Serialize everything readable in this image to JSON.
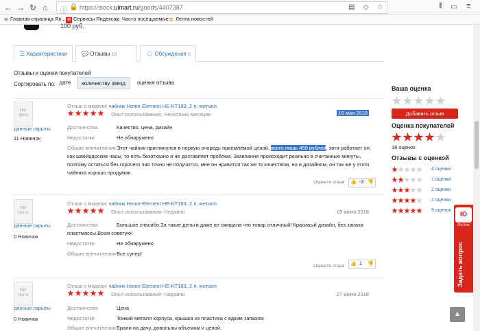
{
  "browser": {
    "url_prefix": "https://stock.",
    "url_host": "ulmart.ru",
    "url_path": "/goods/4407387",
    "bookmarks": [
      {
        "icon": "yandex-icon",
        "label": "Главная страница Ян..."
      },
      {
        "icon": "yandex-services-icon",
        "label": "Сервисы Яндекса"
      },
      {
        "icon": "gear-icon",
        "label": "Часто посещаемые"
      },
      {
        "icon": "news-icon",
        "label": "Лента новостей"
      }
    ]
  },
  "product": {
    "price_fragment": "100 руб."
  },
  "tabs": [
    {
      "label": "Характеристики",
      "count": ""
    },
    {
      "label": "Отзывы",
      "count": "18"
    },
    {
      "label": "Обсуждения",
      "count": "0"
    }
  ],
  "reviews_section": {
    "title": "Отзывы и оценки покупателей",
    "sort_label": "Сортировать по:",
    "sort_options": [
      "дате",
      "количеству звезд",
      "оценке отзыва"
    ]
  },
  "reviews": [
    {
      "avatar": "Нет фото",
      "hidden": "данные скрыты",
      "rank": "11 Новичок",
      "model_prefix": "Отзыв о модели:",
      "model": "чайник Home-Element HE-KT183, 2 л, металл",
      "stars": 5,
      "experience": "Опыт использования: Несколько месяцев",
      "date": "16 мая 2018",
      "pros_label": "Достоинства",
      "pros": "Качество, цена, дизайн",
      "cons_label": "Недостатки",
      "cons": "Не обнаружено",
      "impression_label": "Общие впечатления",
      "impression_before": "Этот чайник приглянулся в первую очередь приемлемой ценой, ",
      "impression_selected": "всего лишь 450 рублей",
      "impression_after": ", хотя работает он, как швейцарские часы, то есть безотказно и не доставляет проблем. Закипание происходит реально в считанные минуты, поэтому остаться без горячего чая точно не получится, мне он нравится так же тк качеством, но и дизайном, он так же у этого чайника хорошо продуман.",
      "rate_label": "Оцените отзыв",
      "votes": "-3"
    },
    {
      "avatar": "Нет фото",
      "hidden": "данные скрыты",
      "rank": "0 Новичок",
      "model_prefix": "Отзыв о модели:",
      "model": "чайник Home-Element HE-KT183, 2 л, металл",
      "stars": 5,
      "experience": "Опыт использования: Недавно",
      "date": "19 июня 2018",
      "pros_label": "Достоинства",
      "pros": "Большое спасибо.За такие деньги даже не ожидала что товар отличный! Красивый дизайн, без запаха пластмассы.Всем советую!",
      "cons_label": "Недостатки",
      "cons": "Не обнаружено",
      "impression_label": "Общие впечатления",
      "impression": "Все супер!",
      "rate_label": "Оцените отзыв",
      "votes": "1"
    },
    {
      "avatar": "Нет фото",
      "hidden": "данные скрыты",
      "rank": "0 Новичок",
      "model_prefix": "Отзыв о модели:",
      "model": "чайник Home-Element HE-KT183, 2 л, металл",
      "stars": 5,
      "experience": "Опыт использования: Недавно",
      "date": "27 июня 2018",
      "pros_label": "Достоинства",
      "pros": "Цена",
      "cons_label": "Недостатки",
      "cons": "Тонкий металл корпуса, крышка из пластика с едким запахом",
      "impression_label": "Общие впечатления",
      "impression": "Брали на дачу, довольны объемом и ценой."
    }
  ],
  "sidebar": {
    "your_rating": "Ваша оценка",
    "add_review": "Добавить отзыв",
    "buyers_rating": "Оценка покупателей",
    "buyers_stars": 4,
    "count": "18 оценок",
    "by_rating_title": "Отзывы с оценкой",
    "distribution": [
      {
        "stars": 1,
        "label": "4 оценки"
      },
      {
        "stars": 2,
        "label": "1 оценка"
      },
      {
        "stars": 3,
        "label": "2 оценки"
      },
      {
        "stars": 4,
        "label": "2 оценки"
      },
      {
        "stars": 5,
        "label": "9 оценок"
      }
    ]
  },
  "widget": {
    "logo": "Ю",
    "online": "On-line",
    "ask": "Задать вопрос"
  },
  "scroll_top_icon": "arrow-up-icon"
}
